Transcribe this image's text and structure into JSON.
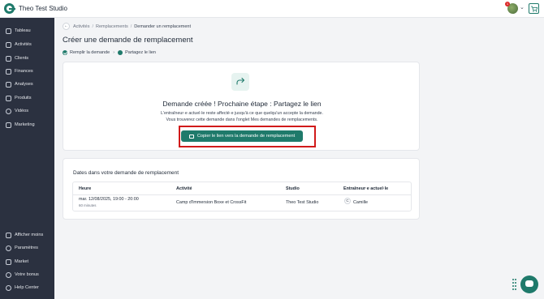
{
  "app": {
    "name": "Theo Test Studio",
    "notification_count": "1",
    "accent": "#1f7a6b"
  },
  "sidebar": {
    "items": [
      {
        "label": "Tableau",
        "icon": "home-icon"
      },
      {
        "label": "Activités",
        "icon": "activity-icon"
      },
      {
        "label": "Clients",
        "icon": "user-icon"
      },
      {
        "label": "Finances",
        "icon": "finance-icon"
      },
      {
        "label": "Analyses",
        "icon": "chart-icon"
      },
      {
        "label": "Produits",
        "icon": "tag-icon"
      },
      {
        "label": "Vidéos",
        "icon": "play-icon"
      },
      {
        "label": "Marketing",
        "icon": "megaphone-icon"
      }
    ],
    "bottom_items": [
      {
        "label": "Afficher moins",
        "icon": "collapse-icon"
      },
      {
        "label": "Paramètres",
        "icon": "gear-icon"
      },
      {
        "label": "Market",
        "icon": "market-icon"
      },
      {
        "label": "Votre bonus",
        "icon": "heart-icon"
      },
      {
        "label": "Help Center",
        "icon": "help-icon"
      }
    ]
  },
  "breadcrumb": {
    "back": "←",
    "items": [
      "Activités",
      "Remplacements",
      "Demander un remplacement"
    ]
  },
  "page": {
    "title": "Créer une demande de remplacement"
  },
  "steps": {
    "step1": "Remplir la demande",
    "separator": "›",
    "step2": "Partagez le lien"
  },
  "confirmation": {
    "heading": "Demande créée ! Prochaine étape : Partagez le lien",
    "line1": "L'entraîneur·e actuel·le reste affecté·e jusqu'à ce que quelqu'un accepte la demande.",
    "line2": "Vous trouverez cette demande dans l'onglet Mes demandes de remplacements.",
    "button": "Copier le lien vers la demande de remplacement"
  },
  "dates": {
    "title": "Dates dans votre demande de remplacement",
    "columns": [
      "Heure",
      "Activité",
      "Studio",
      "Entraîneur·e actuel·le"
    ],
    "rows": [
      {
        "time": "mar. 12/08/2025, 19:00 - 20:00",
        "duration": "60 minutes",
        "activity": "Camp d'Immersion Boxe et CrossFit",
        "studio": "Theo Test Studio",
        "coach_initial": "C",
        "coach": "Camille"
      }
    ]
  }
}
